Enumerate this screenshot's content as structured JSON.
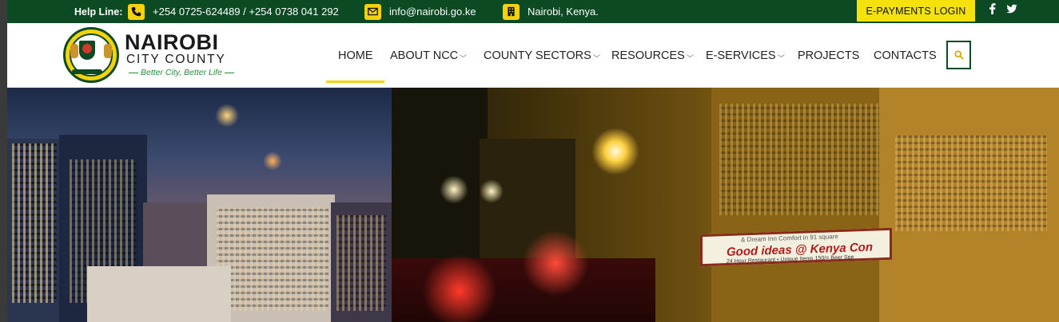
{
  "topbar": {
    "helpline_label": "Help Line:",
    "phone": "+254 0725-624489 / +254 0738 041 292",
    "email": "info@nairobi.go.ke",
    "location": "Nairobi, Kenya.",
    "payments_button": "E-PAYMENTS LOGIN"
  },
  "logo": {
    "name": "NAIROBI",
    "subname": "CITY COUNTY",
    "tagline": "Better City, Better Life"
  },
  "nav": {
    "items": [
      {
        "label": "HOME",
        "dropdown": false,
        "active": true
      },
      {
        "label": "ABOUT NCC",
        "dropdown": true
      },
      {
        "label": "COUNTY SECTORS",
        "dropdown": true
      },
      {
        "label": "RESOURCES",
        "dropdown": true
      },
      {
        "label": "E-SERVICES",
        "dropdown": true
      },
      {
        "label": "PROJECTS",
        "dropdown": false
      },
      {
        "label": "CONTACTS",
        "dropdown": false
      }
    ],
    "chevron": "⌵"
  },
  "hero": {
    "sign_small": "& Dream Inn Comfort in 91 square",
    "sign_big": "Good ideas @ Kenya Con",
    "sign_bottom": "24 Hour Restaurant • Unique Items 150/= Beer Spe"
  },
  "colors": {
    "brand_green": "#0b4a23",
    "accent_yellow": "#f5d20a",
    "payments_yellow": "#f5e10c"
  },
  "icons": [
    "phone-icon",
    "envelope-icon",
    "building-icon",
    "facebook-icon",
    "twitter-icon",
    "search-icon",
    "chevron-down-icon"
  ]
}
